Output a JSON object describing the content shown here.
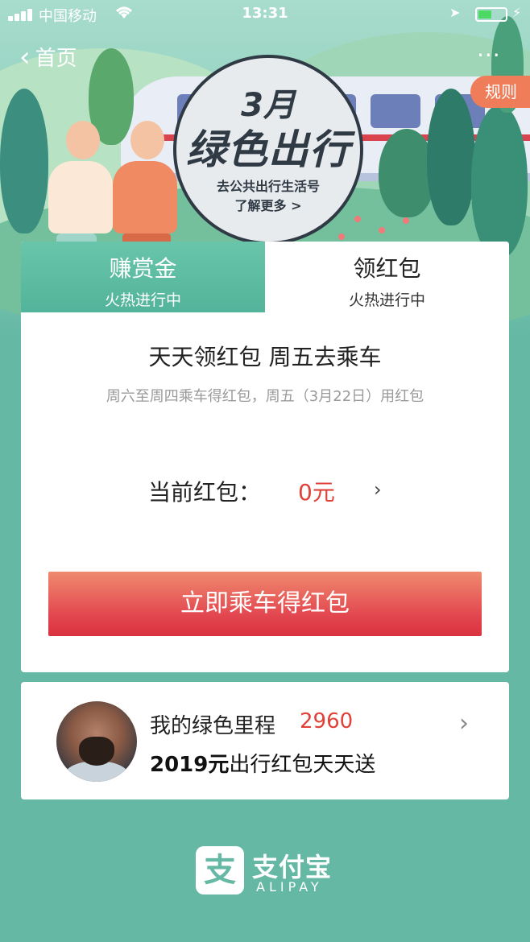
{
  "status_bar": {
    "carrier": "中国移动",
    "time": "13:31"
  },
  "nav": {
    "back_label": "首页",
    "rules_label": "规则",
    "more_label": "···"
  },
  "badge": {
    "month": "3月",
    "title": "绿色出行",
    "subtitle": "去公共出行生活号",
    "link": "了解更多 >"
  },
  "tabs": [
    {
      "label": "赚赏金",
      "status": "火热进行中"
    },
    {
      "label": "领红包",
      "status": "火热进行中"
    }
  ],
  "promo": {
    "title": "天天领红包 周五去乘车",
    "subtitle": "周六至周四乘车得红包，周五（3月22日）用红包",
    "current_label": "当前红包：",
    "current_value": "0元",
    "arrow": "›",
    "cta_label": "立即乘车得红包"
  },
  "mileage": {
    "label": "我的绿色里程",
    "value": "2960",
    "promo_bold": "2019元",
    "promo_rest": "出行红包天天送",
    "arrow": "›"
  },
  "footer": {
    "logo_glyph": "支",
    "brand_cn": "支付宝",
    "brand_en": "ALIPAY"
  },
  "colors": {
    "background": "#64b8a4",
    "accent_red": "#e0423a",
    "tab_active": "#5dbca1",
    "rules_orange": "#ef7d5a"
  }
}
